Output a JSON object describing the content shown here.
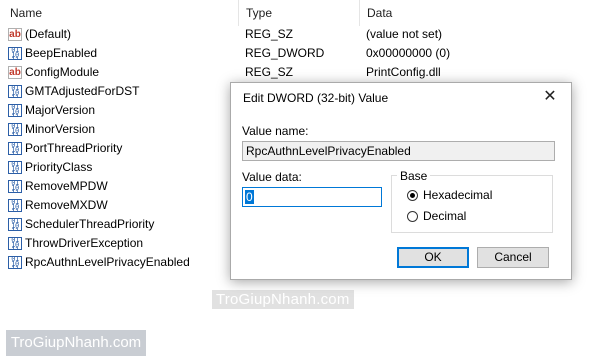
{
  "header": {
    "name": "Name",
    "type": "Type",
    "data": "Data"
  },
  "rows": [
    {
      "icon": "string-value-icon",
      "name": "(Default)",
      "type": "REG_SZ",
      "data": "(value not set)"
    },
    {
      "icon": "dword-value-icon",
      "name": "BeepEnabled",
      "type": "REG_DWORD",
      "data": "0x00000000 (0)"
    },
    {
      "icon": "string-value-icon",
      "name": "ConfigModule",
      "type": "REG_SZ",
      "data": "PrintConfig.dll"
    },
    {
      "icon": "dword-value-icon",
      "name": "GMTAdjustedForDST",
      "type": "",
      "data": ""
    },
    {
      "icon": "dword-value-icon",
      "name": "MajorVersion",
      "type": "",
      "data": ""
    },
    {
      "icon": "dword-value-icon",
      "name": "MinorVersion",
      "type": "",
      "data": ""
    },
    {
      "icon": "dword-value-icon",
      "name": "PortThreadPriority",
      "type": "",
      "data": ""
    },
    {
      "icon": "dword-value-icon",
      "name": "PriorityClass",
      "type": "",
      "data": ""
    },
    {
      "icon": "dword-value-icon",
      "name": "RemoveMPDW",
      "type": "",
      "data": ""
    },
    {
      "icon": "dword-value-icon",
      "name": "RemoveMXDW",
      "type": "",
      "data": ""
    },
    {
      "icon": "dword-value-icon",
      "name": "SchedulerThreadPriority",
      "type": "",
      "data": ""
    },
    {
      "icon": "dword-value-icon",
      "name": "ThrowDriverException",
      "type": "",
      "data": ""
    },
    {
      "icon": "dword-value-icon",
      "name": "RpcAuthnLevelPrivacyEnabled",
      "type": "",
      "data": ""
    }
  ],
  "dialog": {
    "title": "Edit DWORD (32-bit) Value",
    "close": "✕",
    "value_name_label": "Value name:",
    "value_name": "RpcAuthnLevelPrivacyEnabled",
    "value_data_label": "Value data:",
    "value_data": "0",
    "base_label": "Base",
    "hex_label": "Hexadecimal",
    "dec_label": "Decimal",
    "selected_base": "Hexadecimal",
    "ok": "OK",
    "cancel": "Cancel"
  },
  "watermarks": {
    "center": "TroGiupNhanh.com",
    "corner": "TroGiupNhanh.com"
  },
  "colors": {
    "accent": "#0078d7",
    "button_face": "#e1e1e1",
    "string_icon": "#c0392b"
  }
}
